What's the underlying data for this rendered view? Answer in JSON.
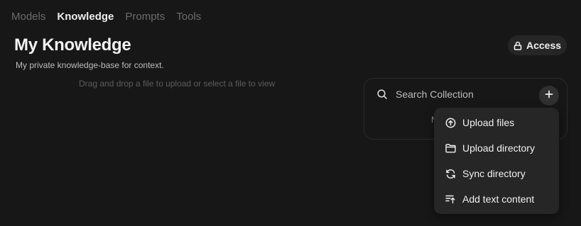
{
  "nav": {
    "tabs": [
      {
        "label": "Models",
        "active": false
      },
      {
        "label": "Knowledge",
        "active": true
      },
      {
        "label": "Prompts",
        "active": false
      },
      {
        "label": "Tools",
        "active": false
      }
    ]
  },
  "header": {
    "title": "My Knowledge",
    "subtitle": "My private knowledge-base for context.",
    "access_label": "Access",
    "access_icon": "lock-icon"
  },
  "main": {
    "drop_hint": "Drag and drop a file to upload or select a file to view"
  },
  "collection": {
    "search_placeholder": "Search Collection",
    "search_value": "",
    "search_icon": "search-icon",
    "add_icon": "plus-icon",
    "empty_text": "N"
  },
  "add_menu": {
    "items": [
      {
        "label": "Upload files",
        "icon": "upload-icon"
      },
      {
        "label": "Upload directory",
        "icon": "folder-icon"
      },
      {
        "label": "Sync directory",
        "icon": "sync-icon"
      },
      {
        "label": "Add text content",
        "icon": "add-text-icon"
      }
    ]
  },
  "colors": {
    "background": "#171717",
    "surface": "#262626",
    "text_primary": "#ececec",
    "text_muted": "#6b6b6b"
  }
}
